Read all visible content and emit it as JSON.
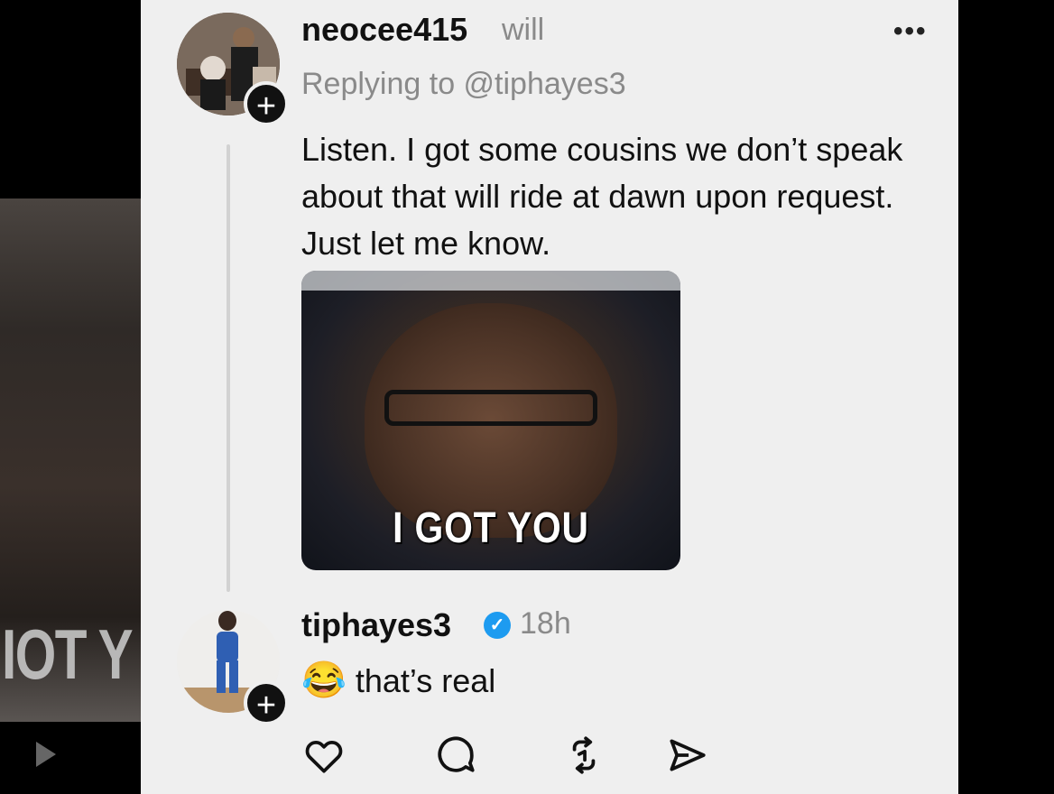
{
  "background": {
    "blur_caption": "IOT Y"
  },
  "posts": [
    {
      "username": "neocee415",
      "meta": "will",
      "replying_to": "Replying to @tiphayes3",
      "text": "Listen.  I got some cousins we don’t speak about that will ride at dawn upon request. Just let me know.",
      "media_caption": "I GOT YOU",
      "more_icon": "more-horizontal-icon"
    },
    {
      "username": "tiphayes3",
      "verified": true,
      "time": "18h",
      "emoji": "😂",
      "text": "that’s real"
    }
  ],
  "actions": [
    {
      "icon": "heart-icon"
    },
    {
      "icon": "comment-icon"
    },
    {
      "icon": "repost-icon"
    },
    {
      "icon": "share-icon"
    }
  ],
  "colors": {
    "card_bg": "#efefef",
    "verified": "#1d9bf0",
    "grey_text": "#8a8a8a"
  }
}
